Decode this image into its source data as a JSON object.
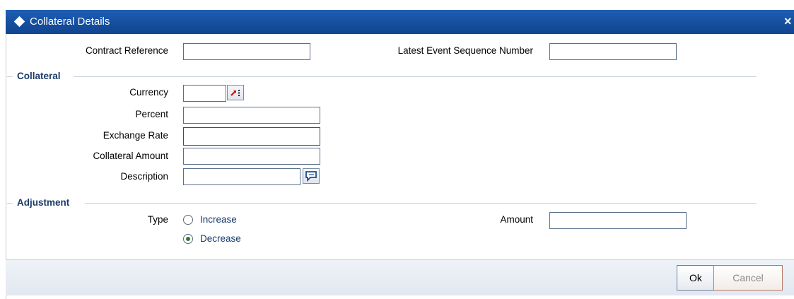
{
  "window": {
    "title": "Collateral Details",
    "close_glyph": "×"
  },
  "header_fields": {
    "contract_reference": {
      "label": "Contract Reference",
      "value": ""
    },
    "latest_event_seq": {
      "label": "Latest Event Sequence Number",
      "value": ""
    }
  },
  "collateral": {
    "section_title": "Collateral",
    "currency": {
      "label": "Currency",
      "value": ""
    },
    "percent": {
      "label": "Percent",
      "value": ""
    },
    "exchange_rate": {
      "label": "Exchange Rate",
      "value": ""
    },
    "collateral_amount": {
      "label": "Collateral Amount",
      "value": ""
    },
    "description": {
      "label": "Description",
      "value": ""
    }
  },
  "adjustment": {
    "section_title": "Adjustment",
    "type_label": "Type",
    "options": [
      {
        "label": "Increase",
        "selected": false
      },
      {
        "label": "Decrease",
        "selected": true
      }
    ],
    "amount": {
      "label": "Amount",
      "value": ""
    }
  },
  "footer": {
    "ok_label": "Ok",
    "cancel_label": "Cancel"
  },
  "icons": {
    "currency_lov": "list-of-values-icon",
    "description_edit": "comment-edit-icon"
  }
}
